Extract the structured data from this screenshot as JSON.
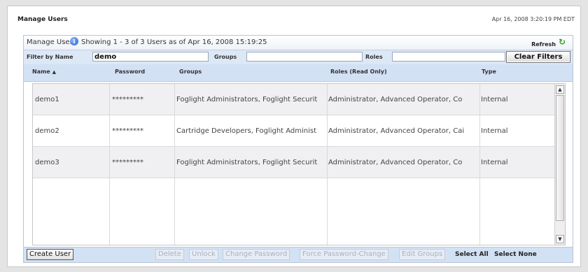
{
  "page": {
    "title": "Manage Users",
    "timestamp": "Apr 16, 2008 3:20:19 PM EDT"
  },
  "panel": {
    "title": "Manage Users",
    "info_icon": "info-icon",
    "status": "Showing 1 - 3  of 3 Users as of Apr 16, 2008 15:19:25",
    "refresh_label": "Refresh",
    "refresh_icon": "refresh-icon"
  },
  "filters": {
    "name_label": "Filter by Name",
    "name_value": "demo",
    "groups_label": "Groups",
    "groups_value": "",
    "roles_label": "Roles",
    "roles_value": "",
    "clear_label": "Clear Filters"
  },
  "columns": {
    "name": "Name",
    "name_sort": "▲",
    "password": "Password",
    "groups": "Groups",
    "roles": "Roles (Read Only)",
    "type": "Type"
  },
  "rows": [
    {
      "name": "demo1",
      "password": "*********",
      "groups": "Foglight Administrators, Foglight Securit",
      "roles": "Administrator, Advanced Operator, Co",
      "type": "Internal"
    },
    {
      "name": "demo2",
      "password": "*********",
      "groups": "Cartridge Developers, Foglight Administ",
      "roles": "Administrator, Advanced Operator, Cai",
      "type": "Internal"
    },
    {
      "name": "demo3",
      "password": "*********",
      "groups": "Foglight Administrators, Foglight Securit",
      "roles": "Administrator, Advanced Operator, Co",
      "type": "Internal"
    }
  ],
  "footer": {
    "create_user": "Create User",
    "delete": "Delete",
    "unlock": "Unlock",
    "change_password": "Change Password",
    "force_password_change": "Force Password-Change",
    "edit_groups": "Edit Groups",
    "select_all": "Select All",
    "select_none": "Select None"
  },
  "colors": {
    "header_blue": "#d3e1f5",
    "filter_blue": "#dde8f7",
    "row_alt": "#f0f0f3",
    "refresh_green": "#3a9a2e"
  }
}
